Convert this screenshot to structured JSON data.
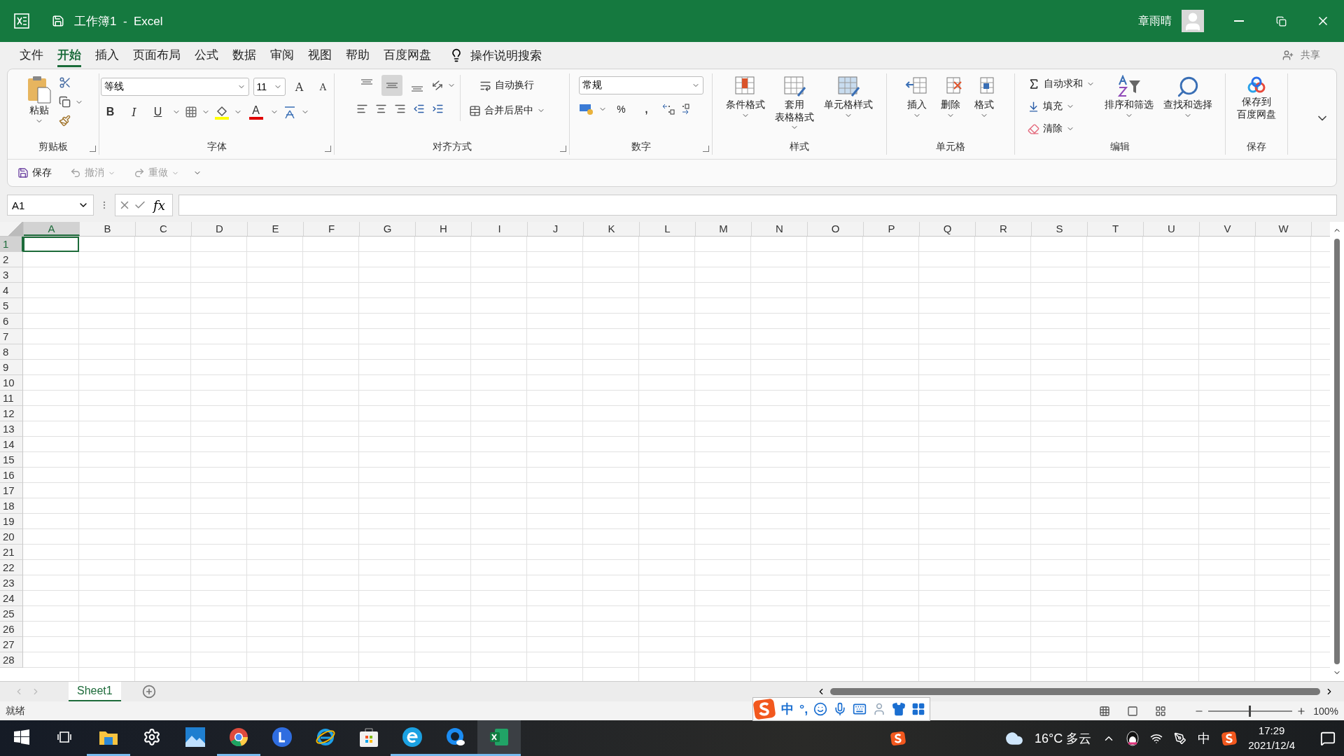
{
  "title_bar": {
    "title": "工作簿1  -  Excel",
    "user_name": "章雨晴"
  },
  "menu_tabs": [
    {
      "label": "文件",
      "selected": false
    },
    {
      "label": "开始",
      "selected": true
    },
    {
      "label": "插入",
      "selected": false
    },
    {
      "label": "页面布局",
      "selected": false
    },
    {
      "label": "公式",
      "selected": false
    },
    {
      "label": "数据",
      "selected": false
    },
    {
      "label": "审阅",
      "selected": false
    },
    {
      "label": "视图",
      "selected": false
    },
    {
      "label": "帮助",
      "selected": false
    },
    {
      "label": "百度网盘",
      "selected": false
    }
  ],
  "tell_me": "操作说明搜索",
  "share": "共享",
  "ribbon": {
    "clipboard": {
      "group": "剪贴板",
      "paste": "粘贴"
    },
    "font": {
      "group": "字体",
      "font_name": "等线",
      "font_size": "11",
      "grow": "A",
      "shrink": "A",
      "bold": "B",
      "italic": "I",
      "underline": "U",
      "font_color": "A"
    },
    "alignment": {
      "group": "对齐方式",
      "vertical": [
        {
          "selected": false
        },
        {
          "selected": true
        },
        {
          "selected": false
        }
      ],
      "wrap": "自动换行",
      "merge": "合并后居中"
    },
    "number": {
      "group": "数字",
      "format": "常规",
      "percent": "%",
      "comma": ","
    },
    "styles": {
      "group": "样式",
      "buttons": [
        {
          "lines": [
            "条件格式"
          ]
        },
        {
          "lines": [
            "套用",
            "表格格式"
          ]
        },
        {
          "lines": [
            "单元格样式"
          ]
        }
      ]
    },
    "cells": {
      "group": "单元格",
      "buttons": [
        "插入",
        "删除",
        "格式"
      ]
    },
    "editing": {
      "group": "编辑",
      "small": [
        "自动求和",
        "填充",
        "清除"
      ],
      "large": [
        "排序和筛选",
        "查找和选择"
      ]
    },
    "save": {
      "group": "保存",
      "lines": [
        "保存到",
        "百度网盘"
      ]
    }
  },
  "quick_access": [
    {
      "label": "保存",
      "disabled": false
    },
    {
      "label": "撤消",
      "disabled": true
    },
    {
      "label": "重做",
      "disabled": true
    }
  ],
  "formula_bar": {
    "name_box": "A1",
    "function_label": "fx"
  },
  "sheet": {
    "columns": [
      {
        "label": "A",
        "selected": true
      },
      {
        "label": "B",
        "selected": false
      },
      {
        "label": "C",
        "selected": false
      },
      {
        "label": "D",
        "selected": false
      },
      {
        "label": "E",
        "selected": false
      },
      {
        "label": "F",
        "selected": false
      },
      {
        "label": "G",
        "selected": false
      },
      {
        "label": "H",
        "selected": false
      },
      {
        "label": "I",
        "selected": false
      },
      {
        "label": "J",
        "selected": false
      },
      {
        "label": "K",
        "selected": false
      },
      {
        "label": "L",
        "selected": false
      },
      {
        "label": "M",
        "selected": false
      },
      {
        "label": "N",
        "selected": false
      },
      {
        "label": "O",
        "selected": false
      },
      {
        "label": "P",
        "selected": false
      },
      {
        "label": "Q",
        "selected": false
      },
      {
        "label": "R",
        "selected": false
      },
      {
        "label": "S",
        "selected": false
      },
      {
        "label": "T",
        "selected": false
      },
      {
        "label": "U",
        "selected": false
      },
      {
        "label": "V",
        "selected": false
      },
      {
        "label": "W",
        "selected": false
      }
    ],
    "rows": [
      {
        "label": "1",
        "selected": true
      },
      {
        "label": "2",
        "selected": false
      },
      {
        "label": "3",
        "selected": false
      },
      {
        "label": "4",
        "selected": false
      },
      {
        "label": "5",
        "selected": false
      },
      {
        "label": "6",
        "selected": false
      },
      {
        "label": "7",
        "selected": false
      },
      {
        "label": "8",
        "selected": false
      },
      {
        "label": "9",
        "selected": false
      },
      {
        "label": "10",
        "selected": false
      },
      {
        "label": "11",
        "selected": false
      },
      {
        "label": "12",
        "selected": false
      },
      {
        "label": "13",
        "selected": false
      },
      {
        "label": "14",
        "selected": false
      },
      {
        "label": "15",
        "selected": false
      },
      {
        "label": "16",
        "selected": false
      },
      {
        "label": "17",
        "selected": false
      },
      {
        "label": "18",
        "selected": false
      },
      {
        "label": "19",
        "selected": false
      },
      {
        "label": "20",
        "selected": false
      },
      {
        "label": "21",
        "selected": false
      },
      {
        "label": "22",
        "selected": false
      },
      {
        "label": "23",
        "selected": false
      },
      {
        "label": "24",
        "selected": false
      },
      {
        "label": "25",
        "selected": false
      },
      {
        "label": "26",
        "selected": false
      },
      {
        "label": "27",
        "selected": false
      },
      {
        "label": "28",
        "selected": false
      }
    ]
  },
  "sheet_tabs": [
    {
      "label": "Sheet1",
      "selected": true
    }
  ],
  "status_bar": {
    "status": "就绪",
    "zoom": "100%",
    "zoom_slider": {
      "level": 0.5
    }
  },
  "ime_toolbar": {
    "mode": "中",
    "punctuation": "°,"
  },
  "taskbar": {
    "apps": [
      {
        "kind": "start",
        "open": false,
        "selected": false
      },
      {
        "kind": "taskview",
        "open": false,
        "selected": false
      },
      {
        "kind": "explorer",
        "open": true,
        "selected": false
      },
      {
        "kind": "settings",
        "open": false,
        "selected": false
      },
      {
        "kind": "photos",
        "open": false,
        "selected": false
      },
      {
        "kind": "chrome",
        "open": true,
        "selected": false
      },
      {
        "kind": "lapp",
        "open": false,
        "selected": false
      },
      {
        "kind": "ie",
        "open": false,
        "selected": false
      },
      {
        "kind": "store",
        "open": false,
        "selected": false
      },
      {
        "kind": "edge",
        "open": true,
        "selected": false
      },
      {
        "kind": "qapp",
        "open": true,
        "selected": false
      },
      {
        "kind": "excel",
        "open": true,
        "selected": true
      }
    ],
    "weather": "16°C 多云",
    "input_mode": "中",
    "time": "17:29",
    "date": "2021/12/4"
  }
}
